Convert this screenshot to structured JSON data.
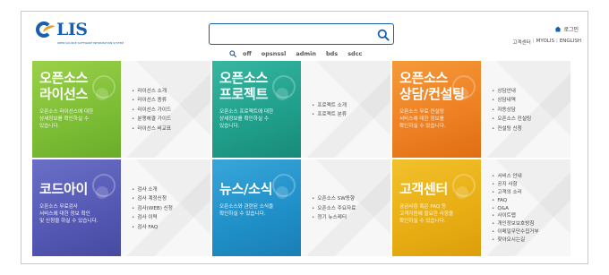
{
  "header": {
    "logo_text": "LIS",
    "logo_sub": "OPEN SOURCE SOFTWARE INFORMATION SYSTEM",
    "search_value": "",
    "search_placeholder": "",
    "keywords": [
      "off",
      "opsnssl",
      "admin",
      "bds",
      "sdcc"
    ],
    "login_label": "로그인",
    "util_links": [
      "고객센터",
      "MYOLIS",
      "ENGLISH"
    ]
  },
  "tiles": [
    {
      "title": "오픈소스\n라이선스",
      "desc": "오픈소스 라이선스에 대한\n상세정보를 확인하실 수\n있습니다.",
      "links": [
        "라이선스 소개",
        "라이선스 종류",
        "라이선스 가이드",
        "분쟁해결 가이드",
        "라이선스 비교표"
      ]
    },
    {
      "title": "오픈소스\n프로젝트",
      "desc": "오픈소스 프로젝트에 대한\n상세정보를 확인하실 수\n있습니다.",
      "links": [
        "프로젝트 소개",
        "프로젝트 분류"
      ]
    },
    {
      "title": "오픈소스\n상담/컨설팅",
      "desc": "오픈소스 무료 컨설팅\n서비스에 대한 정보를\n확인하실 수 있습니다.",
      "links": [
        "상담안내",
        "상담내역",
        "자동상담",
        "오픈소스 컨설팅",
        "컨설팅 신청"
      ]
    },
    {
      "title": "코드아이",
      "desc": "오픈소스 무료검사\n서비스에 대한 정보 확인\n및 신청을 하실 수 있습니다.",
      "links": [
        "검사 소개",
        "검사 계정신청",
        "검사(WEB) 신청",
        "검사 이력",
        "검사 FAQ"
      ]
    },
    {
      "title": "뉴스/소식",
      "desc": "오픈소스와 관련된 소식을\n확인하실 수 있습니다.",
      "links": [
        "오픈소스 SW동향",
        "오픈소스 주요자료",
        "정기 뉴스레터"
      ]
    },
    {
      "title": "고객센터",
      "desc": "궁금사항 혹은 FAQ 등\n고객지원에 필요한 사항을\n확인하실 수 있습니다.",
      "links": [
        "서비스 안내",
        "공지 사항",
        "고객의 소리",
        "FAQ",
        "Q&A",
        "사이트맵",
        "개인정보보호방침",
        "이메일무단수집거부",
        "찾아오시는길"
      ]
    }
  ],
  "colors": {
    "brand": "#1a5fae",
    "accent_logo": "#f39a1d",
    "license": "#7cbd35",
    "project": "#1f9f8b",
    "consulting": "#ee7f22",
    "codeeye": "#5458b3",
    "news": "#1f8fc8",
    "support": "#e8ad13"
  },
  "icons": {
    "search": "search-icon",
    "keyword": "search-icon",
    "home": "home-icon"
  }
}
